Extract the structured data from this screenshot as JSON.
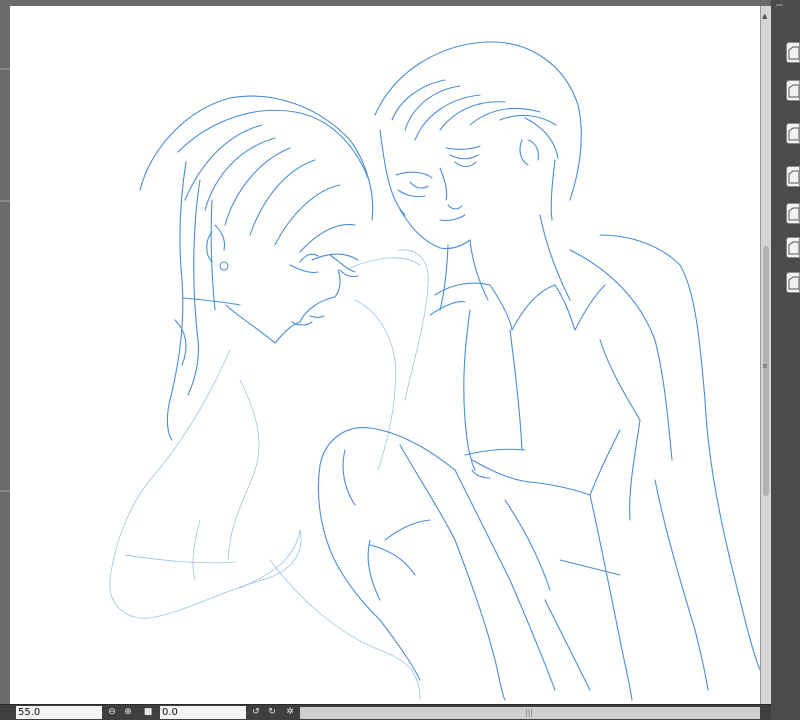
{
  "statusbar": {
    "zoom_value": "55.0",
    "angle_value": "0.0",
    "zoom_out_icon": "zoom-out-icon",
    "zoom_in_icon": "zoom-in-icon",
    "fit_icon": "fit-screen-icon",
    "rotate_left_icon": "rotate-left-icon",
    "rotate_right_icon": "rotate-right-icon",
    "reset_rotation_icon": "reset-rotation-icon"
  },
  "canvas": {
    "background": "#ffffff",
    "stroke_color": "#4a8ed8",
    "stroke_color_light": "#9fc2e8",
    "content": "blue line sketch of two anime-style figures"
  },
  "panel": {
    "thumbnail_count": 7,
    "thumbnail_icon": "layer-thumbnail-icon"
  },
  "colors": {
    "panel_dark": "#4b4b4b",
    "statusbar": "#3f3f3f",
    "scrollbar": "#d6d6d6"
  }
}
